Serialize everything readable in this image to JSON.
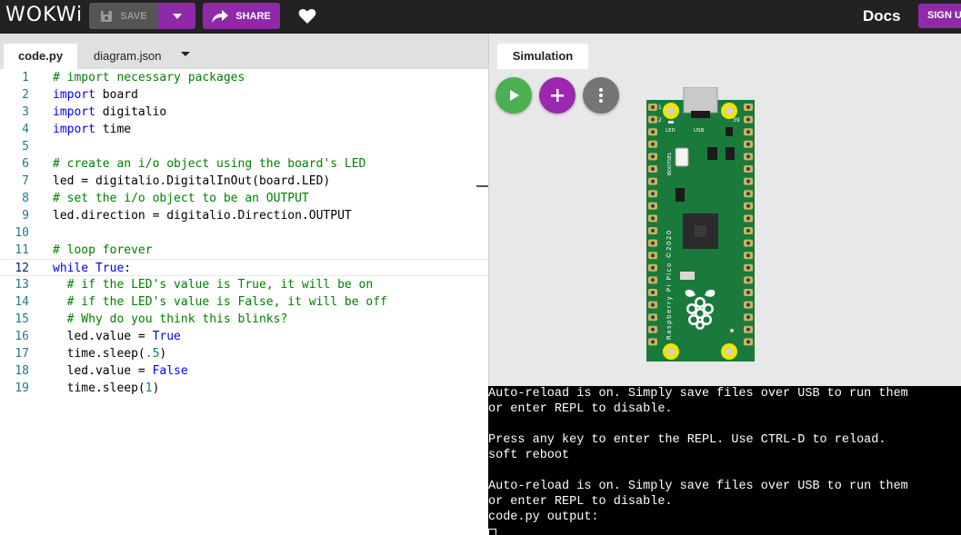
{
  "header": {
    "logo": "WOKWi",
    "save_label": "SAVE",
    "share_label": "SHARE",
    "docs_label": "Docs",
    "signup_label": "SIGN UP",
    "icons": [
      "save-icon",
      "chevron-down-icon",
      "share-icon",
      "heart-icon"
    ],
    "accent_color": "#8e2aa8"
  },
  "editor": {
    "tabs": [
      {
        "label": "code.py",
        "active": true
      },
      {
        "label": "diagram.json",
        "active": false
      }
    ],
    "current_line": 12,
    "lines": [
      {
        "n": "1",
        "tokens": [
          {
            "t": "# import necessary packages",
            "c": "comment"
          }
        ]
      },
      {
        "n": "2",
        "tokens": [
          {
            "t": "import",
            "c": "kw"
          },
          {
            "t": " board",
            "c": ""
          }
        ]
      },
      {
        "n": "3",
        "tokens": [
          {
            "t": "import",
            "c": "kw"
          },
          {
            "t": " digitalio",
            "c": ""
          }
        ]
      },
      {
        "n": "4",
        "tokens": [
          {
            "t": "import",
            "c": "kw"
          },
          {
            "t": " time",
            "c": ""
          }
        ]
      },
      {
        "n": "5",
        "tokens": []
      },
      {
        "n": "6",
        "tokens": [
          {
            "t": "# create an i/o object using the board's LED",
            "c": "comment"
          }
        ]
      },
      {
        "n": "7",
        "tokens": [
          {
            "t": "led = digitalio.DigitalInOut(board.LED)",
            "c": ""
          }
        ]
      },
      {
        "n": "8",
        "tokens": [
          {
            "t": "# set the i/o object to be an OUTPUT",
            "c": "comment"
          }
        ]
      },
      {
        "n": "9",
        "tokens": [
          {
            "t": "led.direction = digitalio.Direction.OUTPUT",
            "c": ""
          }
        ]
      },
      {
        "n": "10",
        "tokens": []
      },
      {
        "n": "11",
        "tokens": [
          {
            "t": "# loop forever",
            "c": "comment"
          }
        ]
      },
      {
        "n": "12",
        "tokens": [
          {
            "t": "while",
            "c": "kw"
          },
          {
            "t": " ",
            "c": ""
          },
          {
            "t": "True",
            "c": "kw"
          },
          {
            "t": ":",
            "c": ""
          }
        ]
      },
      {
        "n": "13",
        "tokens": [
          {
            "t": "  ",
            "c": ""
          },
          {
            "t": "# if the LED's value is True, it will be on",
            "c": "comment"
          }
        ]
      },
      {
        "n": "14",
        "tokens": [
          {
            "t": "  ",
            "c": ""
          },
          {
            "t": "# if the LED's value is False, it will be off",
            "c": "comment"
          }
        ]
      },
      {
        "n": "15",
        "tokens": [
          {
            "t": "  ",
            "c": ""
          },
          {
            "t": "# Why do you think this blinks?",
            "c": "comment"
          }
        ]
      },
      {
        "n": "16",
        "tokens": [
          {
            "t": "  led.value = ",
            "c": ""
          },
          {
            "t": "True",
            "c": "kw"
          }
        ]
      },
      {
        "n": "17",
        "tokens": [
          {
            "t": "  time.sleep(",
            "c": ""
          },
          {
            "t": ".5",
            "c": "num"
          },
          {
            "t": ")",
            "c": ""
          }
        ]
      },
      {
        "n": "18",
        "tokens": [
          {
            "t": "  led.value = ",
            "c": ""
          },
          {
            "t": "False",
            "c": "kw"
          }
        ]
      },
      {
        "n": "19",
        "tokens": [
          {
            "t": "  time.sleep(",
            "c": ""
          },
          {
            "t": "1",
            "c": "num"
          },
          {
            "t": ")",
            "c": ""
          }
        ]
      }
    ]
  },
  "simulation": {
    "tab_label": "Simulation",
    "buttons": [
      "play-icon",
      "plus-icon",
      "more-vert-icon"
    ],
    "board": {
      "led_label": "LED",
      "usb_label": "USB",
      "bootsel_label": "BOOTSEL",
      "pin_left_label": "2",
      "pin_right_label": "39",
      "pin_tl_label": "1",
      "silkscreen": "Raspberry Pi Pico ©2020",
      "board_color": "#1a7a3c"
    }
  },
  "console": {
    "lines": [
      "Auto-reload is on. Simply save files over USB to run them",
      "or enter REPL to disable.",
      "",
      "Press any key to enter the REPL. Use CTRL-D to reload.",
      "soft reboot",
      "",
      "Auto-reload is on. Simply save files over USB to run them",
      "or enter REPL to disable.",
      "code.py output:"
    ]
  }
}
